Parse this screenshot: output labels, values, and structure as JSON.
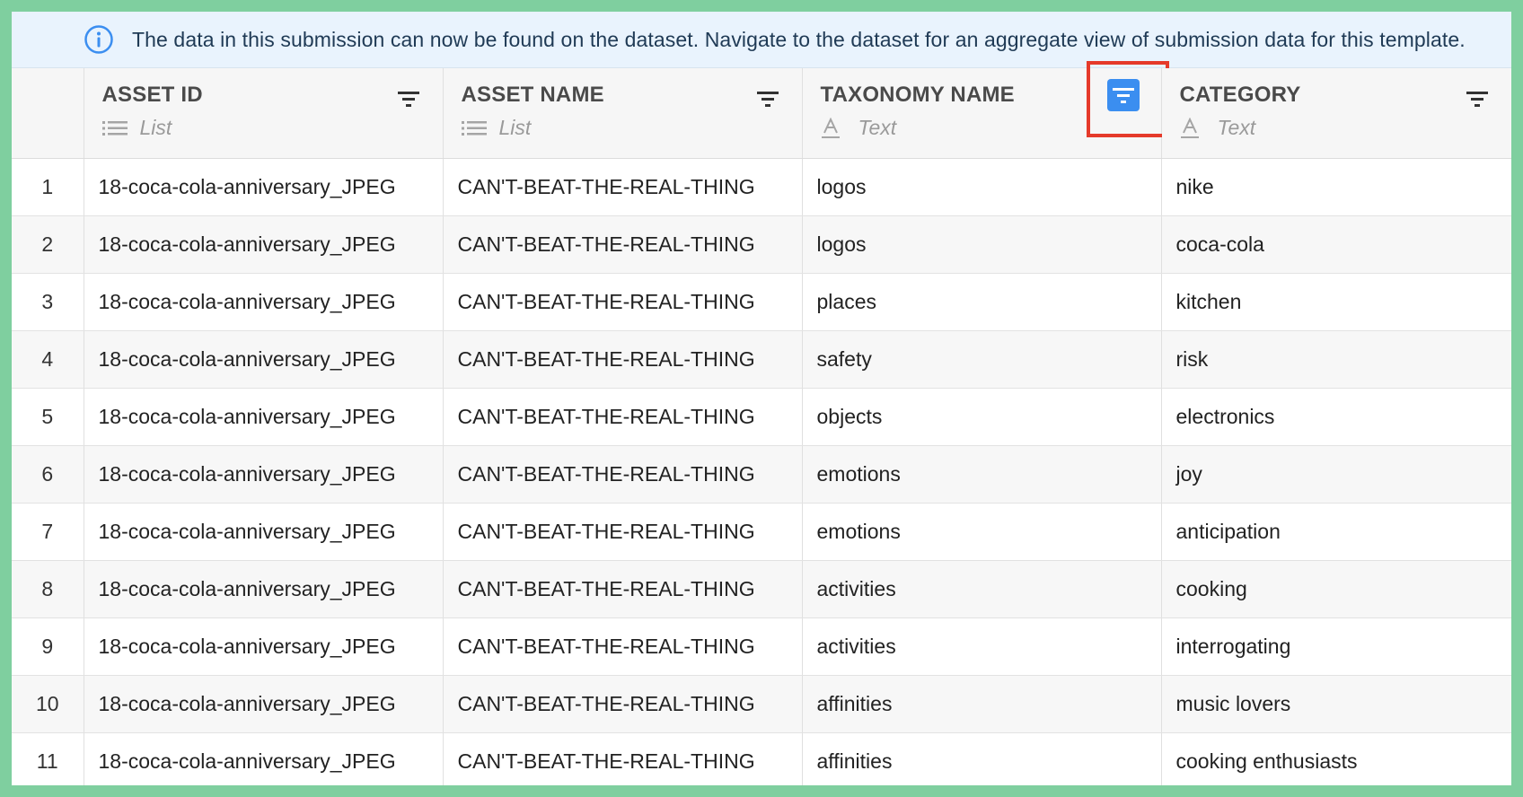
{
  "banner": {
    "icon": "info-icon",
    "message": "The data in this submission can now be found on the dataset. Navigate to the dataset for an aggregate view of submission data for this template."
  },
  "columns": [
    {
      "title": "ASSET ID",
      "type_label": "List",
      "type_icon": "list-icon",
      "filter_active": false
    },
    {
      "title": "ASSET NAME",
      "type_label": "List",
      "type_icon": "list-icon",
      "filter_active": false
    },
    {
      "title": "TAXONOMY NAME",
      "type_label": "Text",
      "type_icon": "text-type-icon",
      "filter_active": true
    },
    {
      "title": "CATEGORY",
      "type_label": "Text",
      "type_icon": "text-type-icon",
      "filter_active": false
    }
  ],
  "rows": [
    {
      "n": "1",
      "asset_id": "18-coca-cola-anniversary_JPEG",
      "asset_name": "CAN'T-BEAT-THE-REAL-THING",
      "taxonomy": "logos",
      "category": "nike"
    },
    {
      "n": "2",
      "asset_id": "18-coca-cola-anniversary_JPEG",
      "asset_name": "CAN'T-BEAT-THE-REAL-THING",
      "taxonomy": "logos",
      "category": "coca-cola"
    },
    {
      "n": "3",
      "asset_id": "18-coca-cola-anniversary_JPEG",
      "asset_name": "CAN'T-BEAT-THE-REAL-THING",
      "taxonomy": "places",
      "category": "kitchen"
    },
    {
      "n": "4",
      "asset_id": "18-coca-cola-anniversary_JPEG",
      "asset_name": "CAN'T-BEAT-THE-REAL-THING",
      "taxonomy": "safety",
      "category": "risk"
    },
    {
      "n": "5",
      "asset_id": "18-coca-cola-anniversary_JPEG",
      "asset_name": "CAN'T-BEAT-THE-REAL-THING",
      "taxonomy": "objects",
      "category": "electronics"
    },
    {
      "n": "6",
      "asset_id": "18-coca-cola-anniversary_JPEG",
      "asset_name": "CAN'T-BEAT-THE-REAL-THING",
      "taxonomy": "emotions",
      "category": "joy"
    },
    {
      "n": "7",
      "asset_id": "18-coca-cola-anniversary_JPEG",
      "asset_name": "CAN'T-BEAT-THE-REAL-THING",
      "taxonomy": "emotions",
      "category": "anticipation"
    },
    {
      "n": "8",
      "asset_id": "18-coca-cola-anniversary_JPEG",
      "asset_name": "CAN'T-BEAT-THE-REAL-THING",
      "taxonomy": "activities",
      "category": "cooking"
    },
    {
      "n": "9",
      "asset_id": "18-coca-cola-anniversary_JPEG",
      "asset_name": "CAN'T-BEAT-THE-REAL-THING",
      "taxonomy": "activities",
      "category": "interrogating"
    },
    {
      "n": "10",
      "asset_id": "18-coca-cola-anniversary_JPEG",
      "asset_name": "CAN'T-BEAT-THE-REAL-THING",
      "taxonomy": "affinities",
      "category": "music lovers"
    },
    {
      "n": "11",
      "asset_id": "18-coca-cola-anniversary_JPEG",
      "asset_name": "CAN'T-BEAT-THE-REAL-THING",
      "taxonomy": "affinities",
      "category": "cooking enthusiasts"
    }
  ],
  "colors": {
    "frame_border": "#7fcf9f",
    "banner_bg": "#e9f3fd",
    "info_icon": "#3b8ef0",
    "active_filter_bg": "#3b8ef0",
    "highlight_box": "#e53a2a"
  }
}
